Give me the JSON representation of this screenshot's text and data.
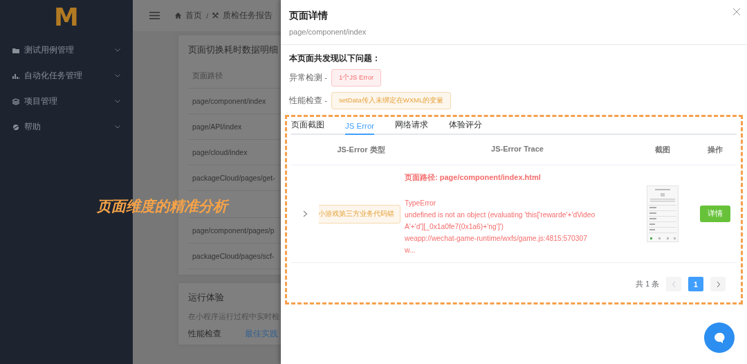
{
  "sidebar": {
    "logo": "M",
    "items": [
      {
        "label": "测试用例管理"
      },
      {
        "label": "自动化任务管理"
      },
      {
        "label": "项目管理"
      },
      {
        "label": "帮助"
      }
    ]
  },
  "header": {
    "separator": "/",
    "breadcrumb": [
      {
        "label": "首页"
      },
      {
        "label": "质检任务报告"
      }
    ]
  },
  "timing_card": {
    "title": "页面切换耗时数据明细",
    "column": "页面路径",
    "rows": [
      {
        "kind": "text",
        "text": "page/component/index"
      },
      {
        "kind": "text",
        "text": "page/API/index"
      },
      {
        "kind": "text",
        "text": "page/cloud/index"
      },
      {
        "kind": "text",
        "text": "packageCloud/pages/get-"
      },
      {
        "kind": "covered"
      },
      {
        "kind": "text",
        "text": "page/component/pages/p"
      },
      {
        "kind": "text",
        "text": "packageCloud/pages/scf-"
      }
    ]
  },
  "experience_card": {
    "title": "运行体验",
    "subtitle": "在小程序运行过程中实时检",
    "items": [
      {
        "label": "性能检查",
        "kind": "label"
      },
      {
        "label": "最佳实践",
        "kind": "link"
      }
    ]
  },
  "caption": "页面维度的精准分析",
  "drawer": {
    "title": "页面详情",
    "subtitle": "page/component/index",
    "summary": "本页面共发现以下问题：",
    "issues": [
      {
        "label": "异常检测 -",
        "tag": "1个JS Error",
        "kind": "error"
      },
      {
        "label": "性能检查 -",
        "tag": "setData传入未绑定在WXML的变量",
        "kind": "warning"
      }
    ],
    "tabs": [
      {
        "label": "页面截图",
        "selected": false
      },
      {
        "label": "JS Error",
        "selected": true
      },
      {
        "label": "网络请求",
        "selected": false
      },
      {
        "label": "体验评分",
        "selected": false
      }
    ],
    "table": {
      "columns": [
        "JS-Error 类型",
        "JS-Error Trace",
        "截图",
        "操作"
      ],
      "rows": [
        {
          "expanded": false,
          "type": "小游戏第三方业务代码错",
          "trace": [
            {
              "kind": "path",
              "text": "页面路径: page/component/index.html"
            },
            {
              "kind": "blank"
            },
            {
              "kind": "line",
              "text": "TypeError"
            },
            {
              "kind": "line",
              "text": "undefined is not an object (evaluating 'this['rewarde'+'dVideo"
            },
            {
              "kind": "line",
              "text": "A'+'d'][_0x1a0fe7(0x1a6)+'ng']')"
            },
            {
              "kind": "line",
              "text": "weapp://wechat-game-runtime/wxfs/game.js:4815:570307"
            },
            {
              "kind": "line",
              "text": "w..."
            }
          ],
          "action": "详情"
        }
      ]
    },
    "pagination": {
      "total": "共 1 条",
      "pages": [
        {
          "label": "1",
          "selected": true
        }
      ],
      "prev_disabled": true,
      "next_disabled": false
    }
  }
}
